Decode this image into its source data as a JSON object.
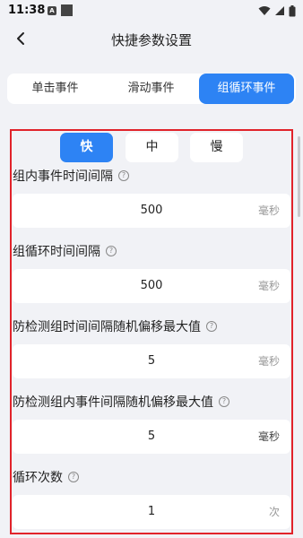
{
  "status": {
    "time": "11:38",
    "a_icon_letter": "A"
  },
  "header": {
    "title": "快捷参数设置"
  },
  "tabs": [
    {
      "label": "单击事件"
    },
    {
      "label": "滑动事件"
    },
    {
      "label": "组循环事件"
    }
  ],
  "active_tab": "组循环事件",
  "speed": [
    {
      "label": "快"
    },
    {
      "label": "中"
    },
    {
      "label": "慢"
    }
  ],
  "active_speed": "快",
  "settings": [
    {
      "label": "组内事件时间间隔",
      "value": "500",
      "unit": "毫秒"
    },
    {
      "label": "组循环时间间隔",
      "value": "500",
      "unit": "毫秒"
    },
    {
      "label": "防检测组时间间隔随机偏移最大值",
      "value": "5",
      "unit": "毫秒"
    },
    {
      "label": "防检测组内事件间隔随机偏移最大值",
      "value": "5",
      "unit": "毫秒"
    },
    {
      "label": "循环次数",
      "value": "1",
      "unit": "次"
    }
  ],
  "help_glyph": "?",
  "colors": {
    "accent": "#2d83f4",
    "highlight_border": "#e1232a",
    "background": "#f1f2f6"
  }
}
